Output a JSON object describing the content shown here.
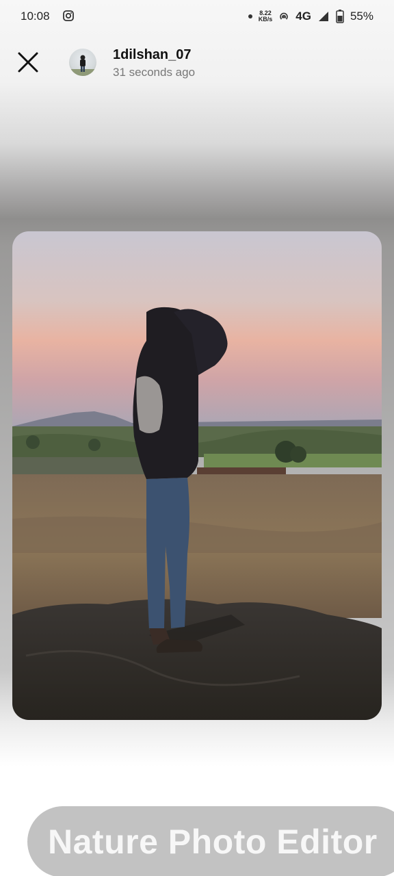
{
  "status_bar": {
    "time": "10:08",
    "speed_top": "8.22",
    "speed_bottom": "KB/s",
    "network": "4G",
    "battery": "55%"
  },
  "header": {
    "username": "1dilshan_07",
    "timestamp": "31 seconds ago"
  },
  "icons": {
    "close": "close-icon",
    "instagram": "instagram-icon",
    "battery": "battery-icon",
    "signal": "signal-icon",
    "hotspot": "hotspot-icon"
  },
  "photo": {
    "description_kind": "story-image"
  },
  "banner": {
    "label": "Nature Photo Editor"
  }
}
